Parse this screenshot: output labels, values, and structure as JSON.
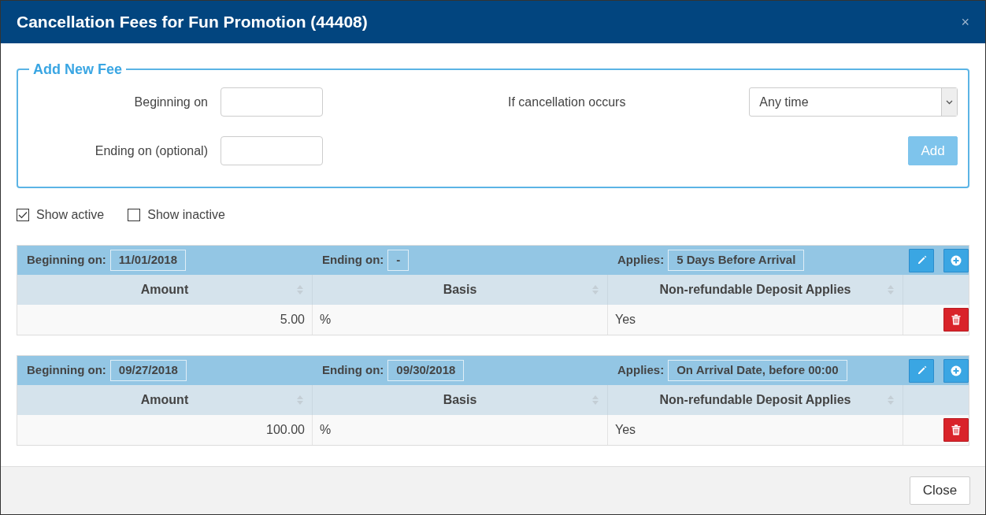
{
  "dialog": {
    "title": "Cancellation Fees for Fun Promotion (44408)",
    "close_glyph": "×"
  },
  "add_fee": {
    "legend": "Add New Fee",
    "beginning": {
      "label": "Beginning on"
    },
    "ending": {
      "label": "Ending on (optional)"
    },
    "occurs": {
      "label": "If cancellation occurs",
      "value": "Any time"
    },
    "add_button": {
      "label": "Add",
      "disabled": true
    }
  },
  "filters": [
    {
      "label": "Show active",
      "checked": true
    },
    {
      "label": "Show inactive",
      "checked": false
    }
  ],
  "fees": [
    {
      "beginning_label": "Beginning on:",
      "beginning": "11/01/2018",
      "ending_label": "Ending on:",
      "ending": "-",
      "applies_label": "Applies:",
      "applies": "5 Days Before Arrival",
      "columns": [
        "Amount",
        "Basis",
        "Non-refundable Deposit Applies"
      ],
      "rows": [
        {
          "amount": "5.00",
          "basis": "%",
          "deposit": "Yes"
        }
      ]
    },
    {
      "beginning_label": "Beginning on:",
      "beginning": "09/27/2018",
      "ending_label": "Ending on:",
      "ending": "09/30/2018",
      "applies_label": "Applies:",
      "applies": "On Arrival Date, before 00:00",
      "columns": [
        "Amount",
        "Basis",
        "Non-refundable Deposit Applies"
      ],
      "rows": [
        {
          "amount": "100.00",
          "basis": "%",
          "deposit": "Yes"
        }
      ]
    }
  ],
  "footer": {
    "close_label": "Close"
  }
}
